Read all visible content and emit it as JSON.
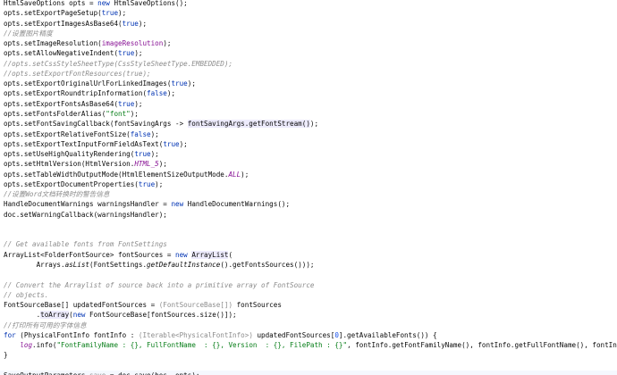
{
  "editor": {
    "lines": [
      [
        {
          "t": "HtmlSaveOptions opts = ",
          "c": "default"
        },
        {
          "t": "new",
          "c": "keyword"
        },
        {
          "t": " HtmlSaveOptions();",
          "c": "default"
        }
      ],
      [
        {
          "t": "opts.setExportPageSetup(",
          "c": "default"
        },
        {
          "t": "true",
          "c": "keyword"
        },
        {
          "t": ");",
          "c": "default"
        }
      ],
      [
        {
          "t": "opts.setExportImagesAsBase64(",
          "c": "default"
        },
        {
          "t": "true",
          "c": "keyword"
        },
        {
          "t": ");",
          "c": "default"
        }
      ],
      [
        {
          "t": "//设置图片精度",
          "c": "comment"
        }
      ],
      [
        {
          "t": "opts.setImageResolution(",
          "c": "default"
        },
        {
          "t": "imageResolution",
          "c": "field"
        },
        {
          "t": ");",
          "c": "default"
        }
      ],
      [
        {
          "t": "opts.setAllowNegativeIndent(",
          "c": "default"
        },
        {
          "t": "true",
          "c": "keyword"
        },
        {
          "t": ");",
          "c": "default"
        }
      ],
      [
        {
          "t": "//opts.setCssStyleSheetType(CssStyleSheetType.EMBEDDED);",
          "c": "comment"
        }
      ],
      [
        {
          "t": "//opts.setExportFontResources(true);",
          "c": "comment"
        }
      ],
      [
        {
          "t": "opts.setExportOriginalUrlForLinkedImages(",
          "c": "default"
        },
        {
          "t": "true",
          "c": "keyword"
        },
        {
          "t": ");",
          "c": "default"
        }
      ],
      [
        {
          "t": "opts.setExportRoundtripInformation(",
          "c": "default"
        },
        {
          "t": "false",
          "c": "keyword"
        },
        {
          "t": ");",
          "c": "default"
        }
      ],
      [
        {
          "t": "opts.setExportFontsAsBase64(",
          "c": "default"
        },
        {
          "t": "true",
          "c": "keyword"
        },
        {
          "t": ");",
          "c": "default"
        }
      ],
      [
        {
          "t": "opts.setFontsFolderAlias(",
          "c": "default"
        },
        {
          "t": "\"font\"",
          "c": "string"
        },
        {
          "t": ");",
          "c": "default"
        }
      ],
      [
        {
          "t": "opts.setFontSavingCallback(fontSavingArgs -> ",
          "c": "default"
        },
        {
          "t": "fontSavingArgs.getFontStream()",
          "c": "hl"
        },
        {
          "t": ");",
          "c": "default"
        }
      ],
      [
        {
          "t": "opts.setExportRelativeFontSize(",
          "c": "default"
        },
        {
          "t": "false",
          "c": "keyword"
        },
        {
          "t": ");",
          "c": "default"
        }
      ],
      [
        {
          "t": "opts.setExportTextInputFormFieldAsText(",
          "c": "default"
        },
        {
          "t": "true",
          "c": "keyword"
        },
        {
          "t": ");",
          "c": "default"
        }
      ],
      [
        {
          "t": "opts.setUseHighQualityRendering(",
          "c": "default"
        },
        {
          "t": "true",
          "c": "keyword"
        },
        {
          "t": ");",
          "c": "default"
        }
      ],
      [
        {
          "t": "opts.setHtmlVersion(HtmlVersion.",
          "c": "default"
        },
        {
          "t": "HTML_5",
          "c": "static-field"
        },
        {
          "t": ");",
          "c": "default"
        }
      ],
      [
        {
          "t": "opts.setTableWidthOutputMode(HtmlElementSizeOutputMode.",
          "c": "default"
        },
        {
          "t": "ALL",
          "c": "static-field"
        },
        {
          "t": ");",
          "c": "default"
        }
      ],
      [
        {
          "t": "opts.setExportDocumentProperties(",
          "c": "default"
        },
        {
          "t": "true",
          "c": "keyword"
        },
        {
          "t": ");",
          "c": "default"
        }
      ],
      [
        {
          "t": "//设置Word文档转换时的警告信息",
          "c": "comment"
        }
      ],
      [
        {
          "t": "HandleDocumentWarnings warningsHandler = ",
          "c": "default"
        },
        {
          "t": "new",
          "c": "keyword"
        },
        {
          "t": " HandleDocumentWarnings();",
          "c": "default"
        }
      ],
      [
        {
          "t": "doc.setWarningCallback(warningsHandler);",
          "c": "default"
        }
      ],
      [],
      [],
      [
        {
          "t": "// Get available fonts from FontSettings",
          "c": "comment"
        }
      ],
      [
        {
          "t": "ArrayList<FolderFontSource> fontSources = ",
          "c": "default"
        },
        {
          "t": "new",
          "c": "keyword"
        },
        {
          "t": " ",
          "c": "default"
        },
        {
          "t": "ArrayList",
          "c": "hl"
        },
        {
          "t": "(",
          "c": "default"
        }
      ],
      [
        {
          "t": "        Arrays.",
          "c": "default"
        },
        {
          "t": "asList",
          "c": "method-italic"
        },
        {
          "t": "(FontSettings.",
          "c": "default"
        },
        {
          "t": "getDefaultInstance",
          "c": "method-italic"
        },
        {
          "t": "().getFontsSources()));",
          "c": "default"
        }
      ],
      [],
      [
        {
          "t": "// Convert the Arraylist of source back into a primitive array of FontSource",
          "c": "comment"
        }
      ],
      [
        {
          "t": "// objects.",
          "c": "comment"
        }
      ],
      [
        {
          "t": "FontSourceBase[] updatedFontSources = ",
          "c": "default"
        },
        {
          "t": "(FontSourceBase[])",
          "c": "unused"
        },
        {
          "t": " fontSources",
          "c": "default"
        }
      ],
      [
        {
          "t": "        .",
          "c": "default"
        },
        {
          "t": "toArray",
          "c": "hl"
        },
        {
          "t": "(",
          "c": "default"
        },
        {
          "t": "new",
          "c": "keyword"
        },
        {
          "t": " FontSourceBase[fontSources.size()]);",
          "c": "default"
        }
      ],
      [
        {
          "t": "//打印所有可用的字体信息",
          "c": "comment"
        }
      ],
      [
        {
          "t": "for",
          "c": "keyword"
        },
        {
          "t": " (PhysicalFontInfo fontInfo : ",
          "c": "default"
        },
        {
          "t": "(Iterable<PhysicalFontInfo>)",
          "c": "unused"
        },
        {
          "t": " updatedFontSources[",
          "c": "default"
        },
        {
          "t": "0",
          "c": "number"
        },
        {
          "t": "].getAvailableFonts()) {",
          "c": "default"
        }
      ],
      [
        {
          "t": "    ",
          "c": "default"
        },
        {
          "t": "log",
          "c": "static-field"
        },
        {
          "t": ".info(",
          "c": "default"
        },
        {
          "t": "\"FontFamilyName : {}, FullFontName  : {}, Version  : {}, FilePath : {}\"",
          "c": "string"
        },
        {
          "t": ", fontInfo.getFontFamilyName(), fontInfo.getFullFontName(), fontInfo.getVersion(), f",
          "c": "default"
        }
      ],
      [
        {
          "t": "}",
          "c": "default"
        }
      ],
      [],
      [
        {
          "t": "SaveOutputParameters ",
          "c": "default"
        },
        {
          "t": "save",
          "c": "unused"
        },
        {
          "t": " = doc.save(bos, opts);",
          "c": "default"
        }
      ]
    ]
  }
}
